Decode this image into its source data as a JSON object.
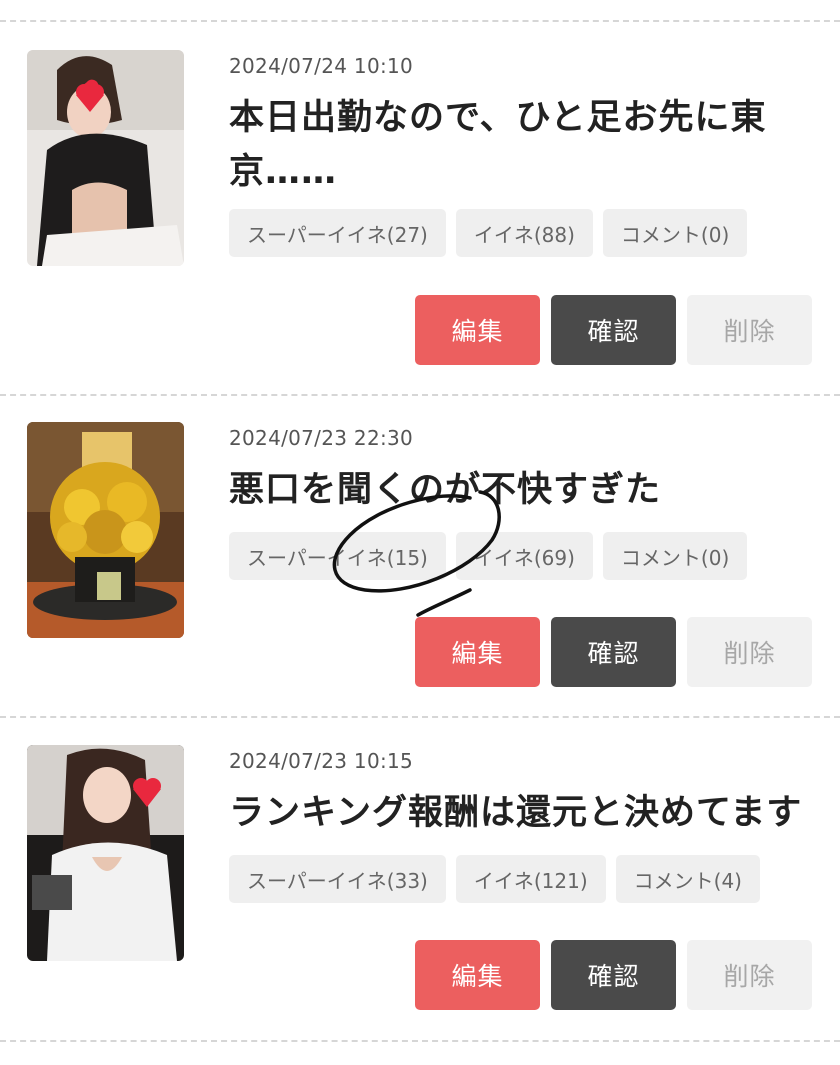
{
  "posts": [
    {
      "date": "2024/07/24 10:10",
      "title": "本日出勤なので、ひと足お先に東京……",
      "tags": {
        "super_like": "スーパーイイネ(27)",
        "like": "イイネ(88)",
        "comment": "コメント(0)"
      },
      "buttons": {
        "edit": "編集",
        "confirm": "確認",
        "delete": "削除"
      }
    },
    {
      "date": "2024/07/23 22:30",
      "title": "悪口を聞くのが不快すぎた",
      "tags": {
        "super_like": "スーパーイイネ(15)",
        "like": "イイネ(69)",
        "comment": "コメント(0)"
      },
      "buttons": {
        "edit": "編集",
        "confirm": "確認",
        "delete": "削除"
      }
    },
    {
      "date": "2024/07/23 10:15",
      "title": "ランキング報酬は還元と決めてます",
      "tags": {
        "super_like": "スーパーイイネ(33)",
        "like": "イイネ(121)",
        "comment": "コメント(4)"
      },
      "buttons": {
        "edit": "編集",
        "confirm": "確認",
        "delete": "削除"
      }
    }
  ],
  "colors": {
    "edit": "#ec5f5f",
    "confirm": "#4a4a4a",
    "delete_bg": "#f1f1f1",
    "tag_bg": "#efefef",
    "divider": "#d6d6d6"
  }
}
